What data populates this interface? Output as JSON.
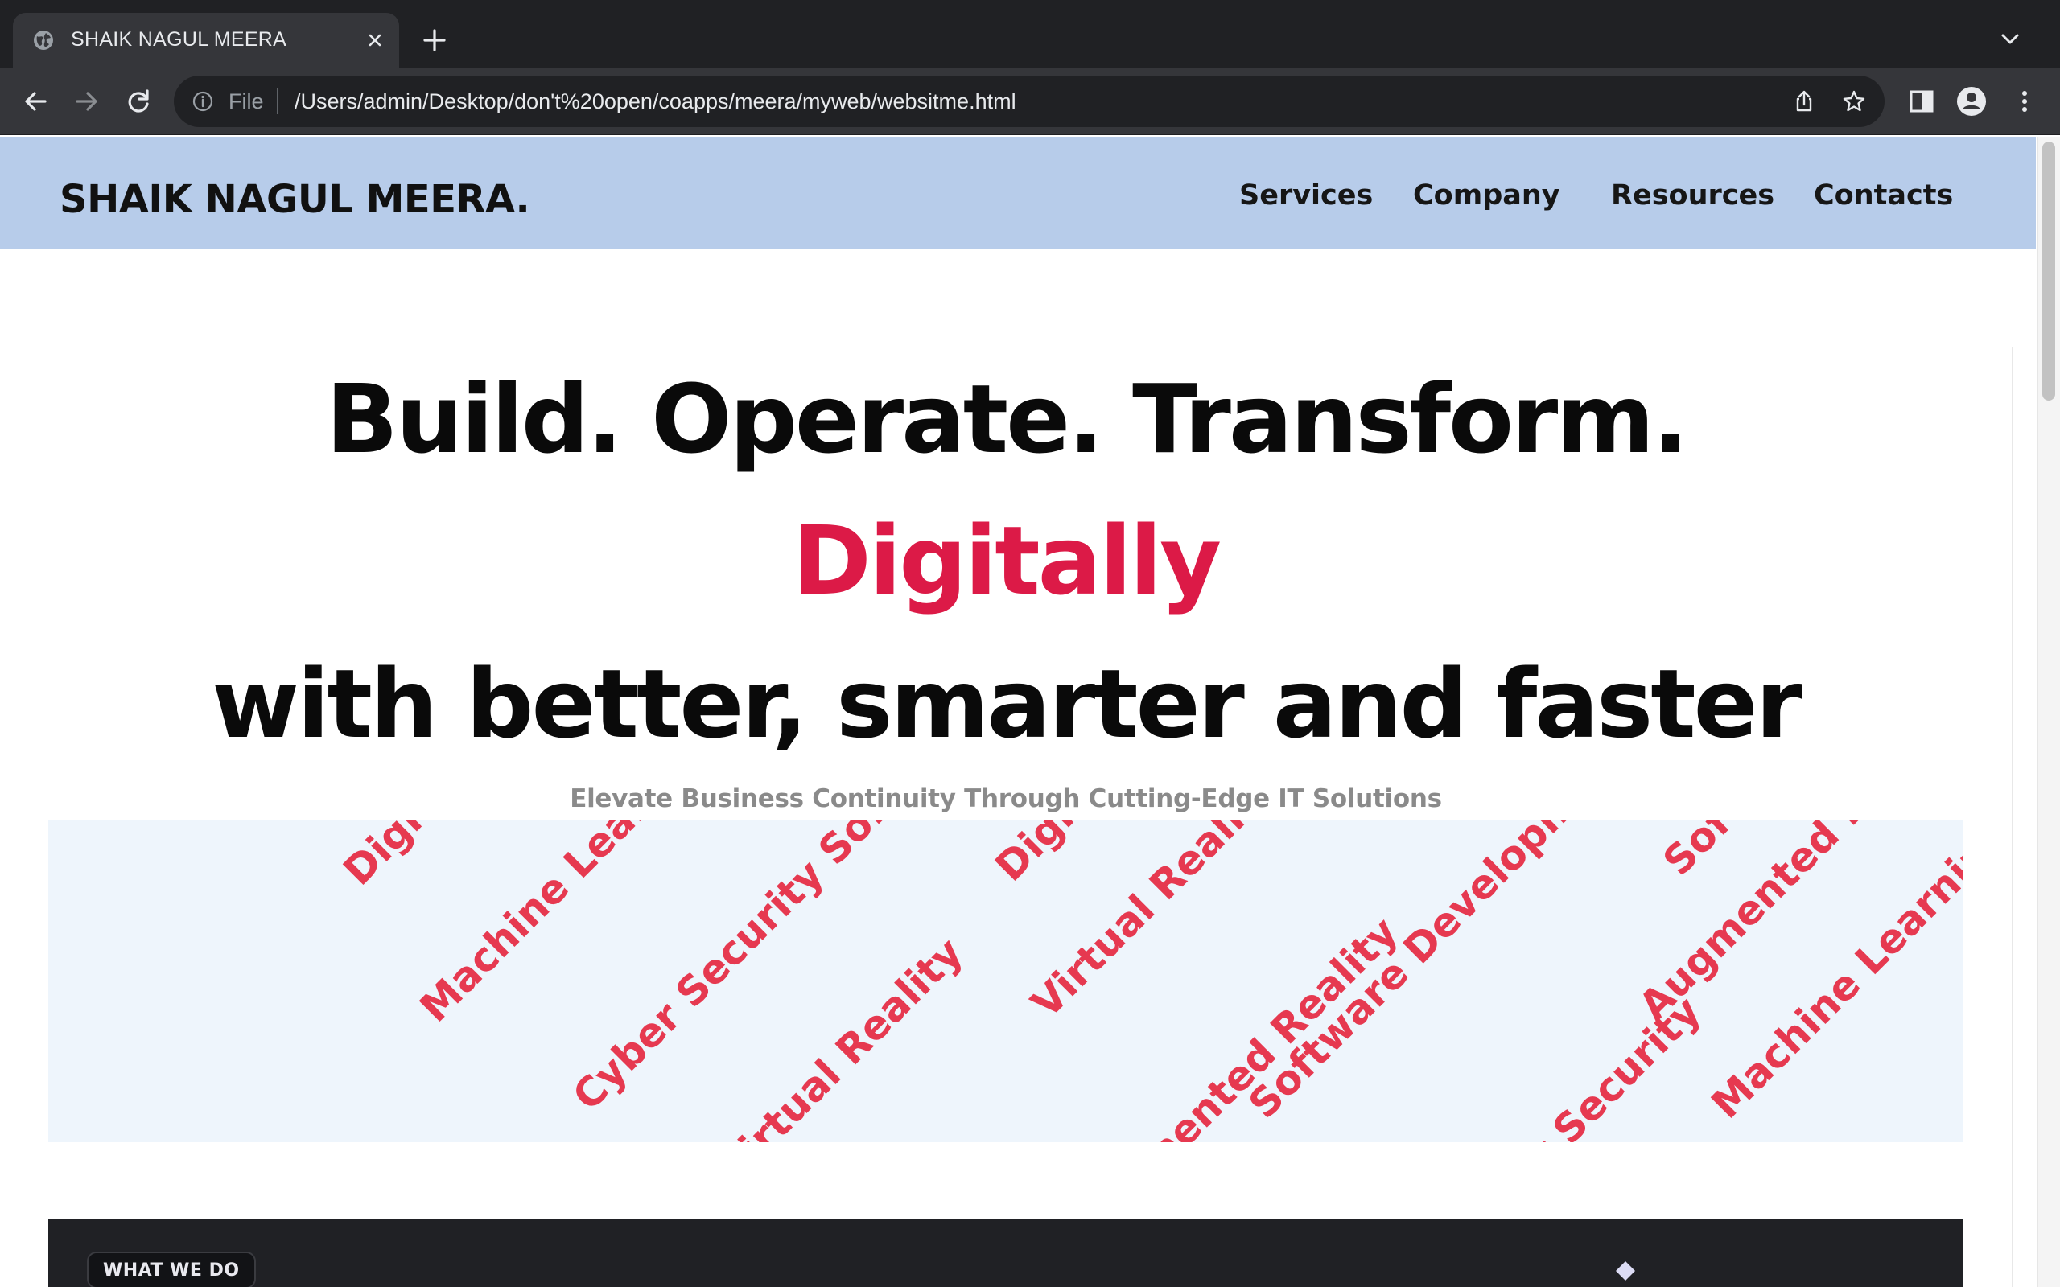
{
  "browser": {
    "tab": {
      "title": "SHAIK NAGUL MEERA",
      "favicon": "globe-icon",
      "close": "close-icon"
    },
    "new_tab": "plus-icon",
    "tab_menu": "chevron-down-icon",
    "omnibox": {
      "scheme_label": "File",
      "url": "/Users/admin/Desktop/don't%20open/coapps/meera/myweb/websitme.html"
    },
    "icons": [
      "back-arrow-icon",
      "forward-arrow-icon",
      "reload-icon",
      "info-icon",
      "share-icon",
      "star-icon",
      "side-panel-icon",
      "profile-icon",
      "kebab-menu-icon"
    ]
  },
  "site": {
    "logo": "SHAIK NAGUL MEERA.",
    "nav": [
      {
        "label": "Services"
      },
      {
        "label": "Company"
      },
      {
        "label": "Resources"
      },
      {
        "label": "Contacts"
      }
    ],
    "hero": {
      "line1": "Build. Operate. Transform.",
      "line2": "Digitally",
      "line3": "with better, smarter and faster",
      "subtitle": "Elevate Business Continuity Through Cutting-Edge IT Solutions"
    },
    "band_words": [
      "Digital Transformation",
      "Machine Learning",
      "Cyber Security Software",
      "Virtual Reality",
      "Digital Transformation",
      "Virtual Reality",
      "Augmented Reality",
      "Software Development",
      "Software Development",
      "Augmented Reality",
      "Cyber Security",
      "Machine Learning"
    ],
    "section": {
      "badge": "WHAT WE DO"
    },
    "colors": {
      "header_bg": "#b7ccea",
      "accent": "#dc1a47",
      "band_text": "#e63950",
      "band_bg": "#eef5fc",
      "dark_bg": "#202125"
    }
  }
}
